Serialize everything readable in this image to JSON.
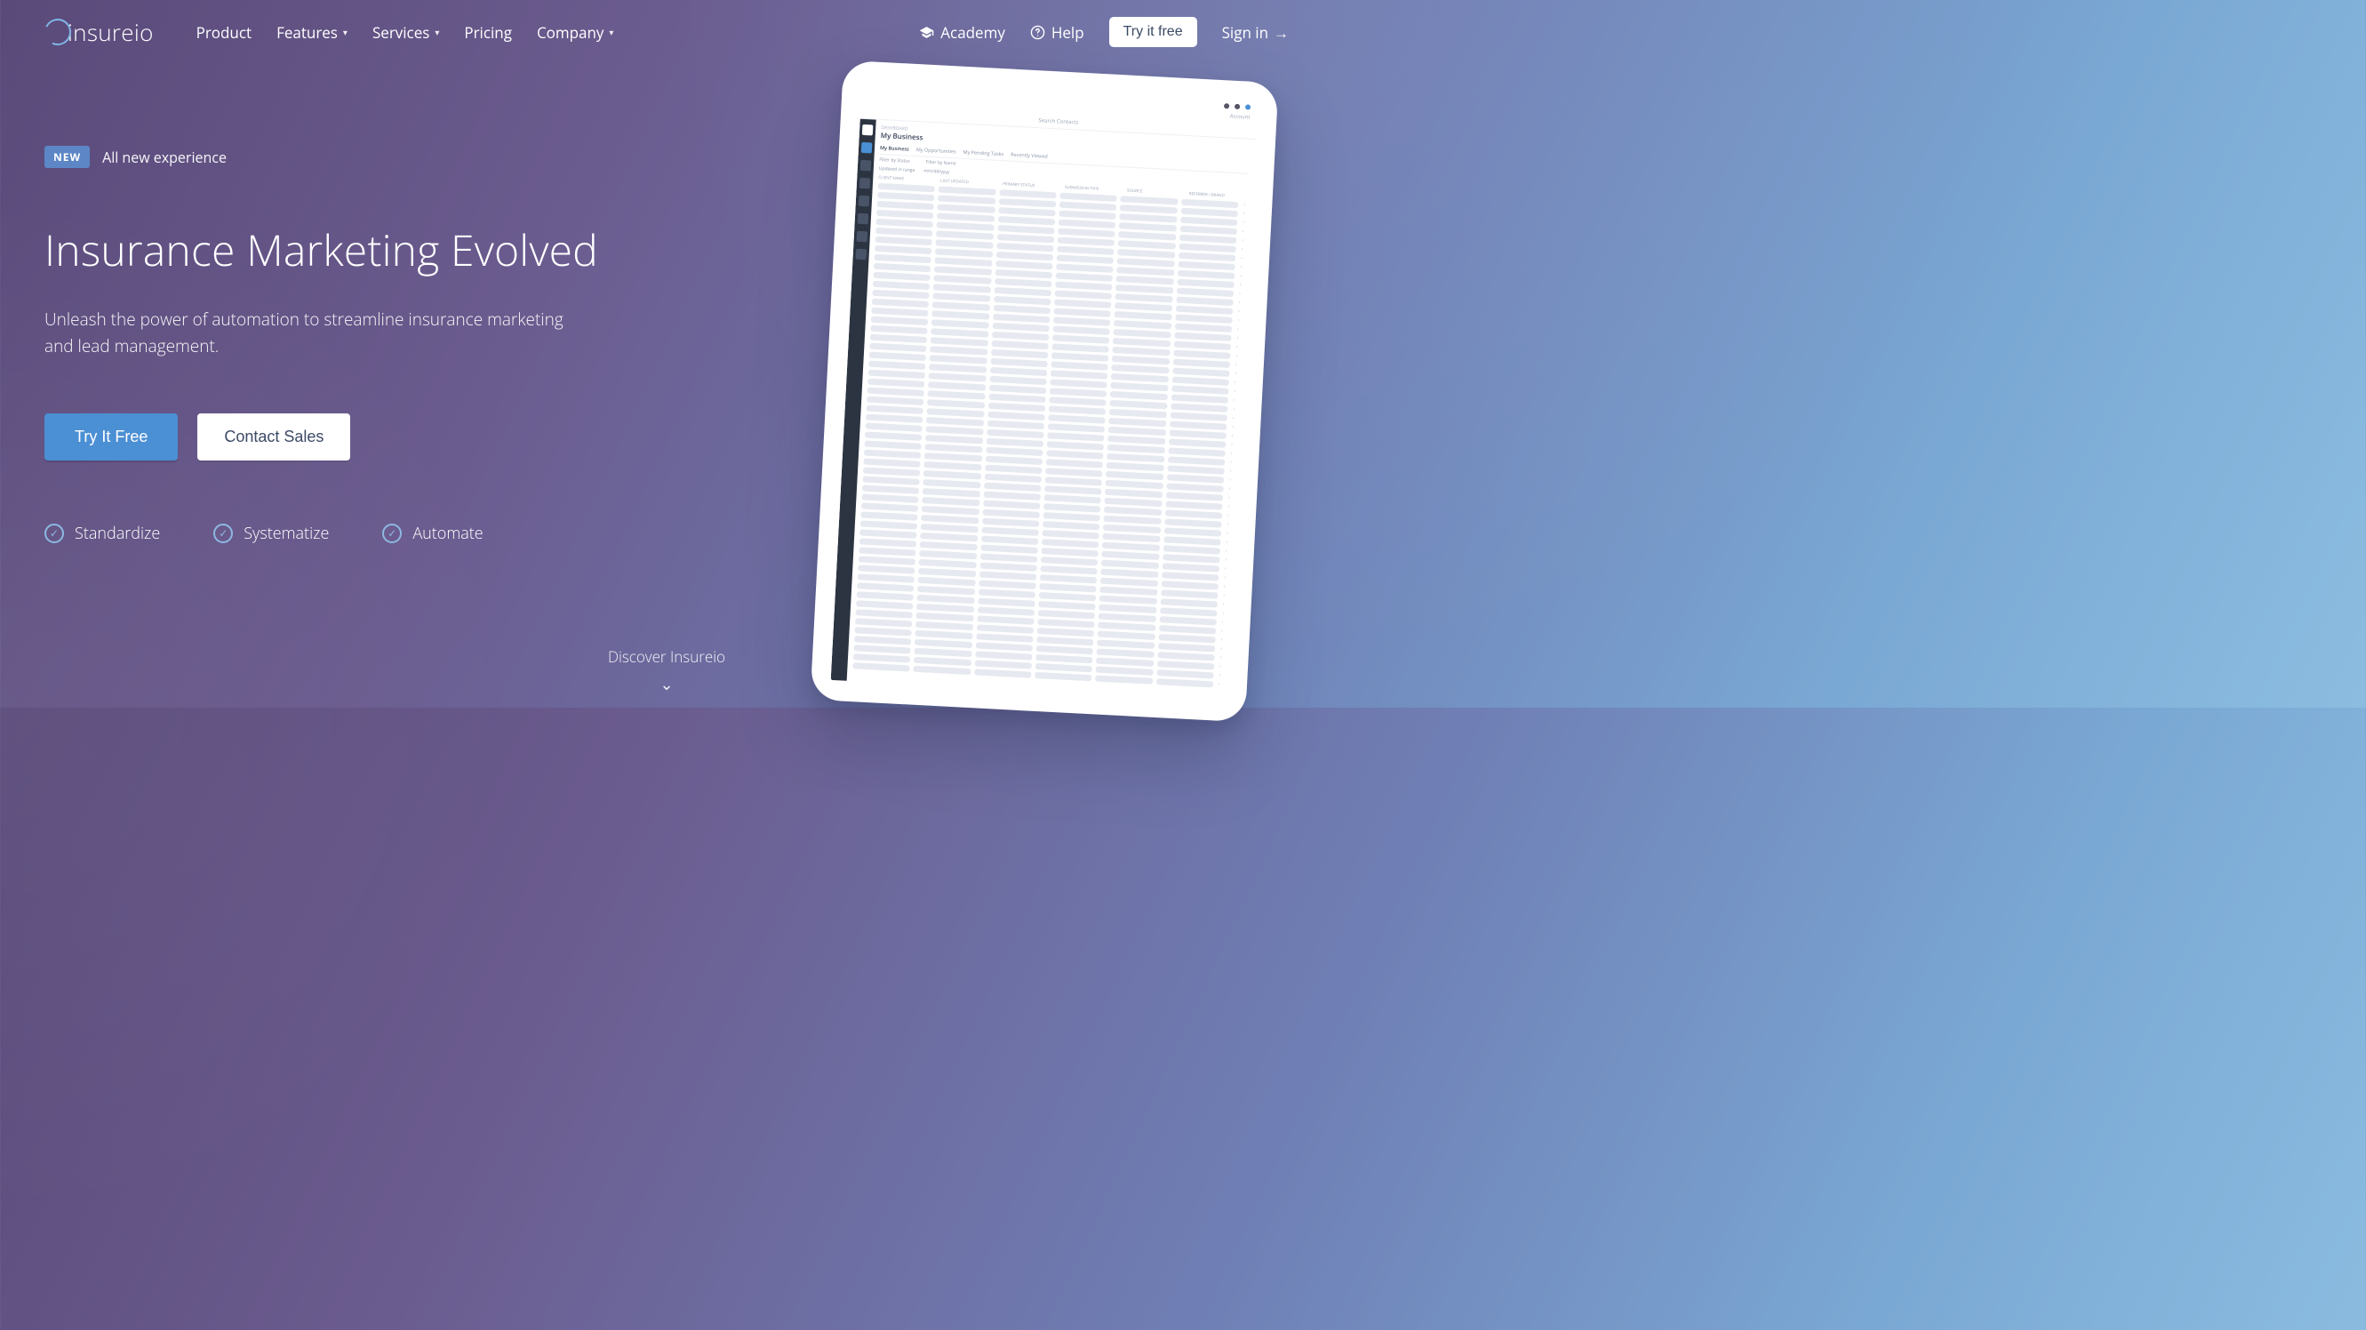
{
  "brand": {
    "name": "insureio"
  },
  "nav": {
    "items": [
      {
        "label": "Product",
        "has_menu": false
      },
      {
        "label": "Features",
        "has_menu": true
      },
      {
        "label": "Services",
        "has_menu": true
      },
      {
        "label": "Pricing",
        "has_menu": false
      },
      {
        "label": "Company",
        "has_menu": true
      }
    ],
    "academy": "Academy",
    "help": "Help",
    "try_it_free": "Try it free",
    "sign_in": "Sign in"
  },
  "hero": {
    "badge": "NEW",
    "badge_text": "All new experience",
    "title": "Insurance Marketing Evolved",
    "subtitle": "Unleash the power of automation to streamline insurance marketing and lead management.",
    "cta_primary": "Try It Free",
    "cta_secondary": "Contact Sales",
    "features": [
      "Standardize",
      "Systematize",
      "Automate"
    ]
  },
  "discover": {
    "label": "Discover Insureio"
  },
  "mockup": {
    "account_label": "Account",
    "search_placeholder": "Search Contacts",
    "breadcrumb": "DASHBOARD",
    "heading": "My Business",
    "tabs": [
      "My Business",
      "My Opportunities",
      "My Pending Tasks",
      "Recently Viewed"
    ],
    "filters": [
      "Filter by Status",
      "Filter by Name"
    ],
    "columns": [
      "CLIENT NAME",
      "LAST UPDATED",
      "PRIMARY STATUS",
      "SUBMISSION TYPE",
      "SOURCE",
      "REFERRER / BRAND"
    ],
    "sub_filters": [
      "Updated in range",
      "mm/dd/yyyy"
    ]
  }
}
